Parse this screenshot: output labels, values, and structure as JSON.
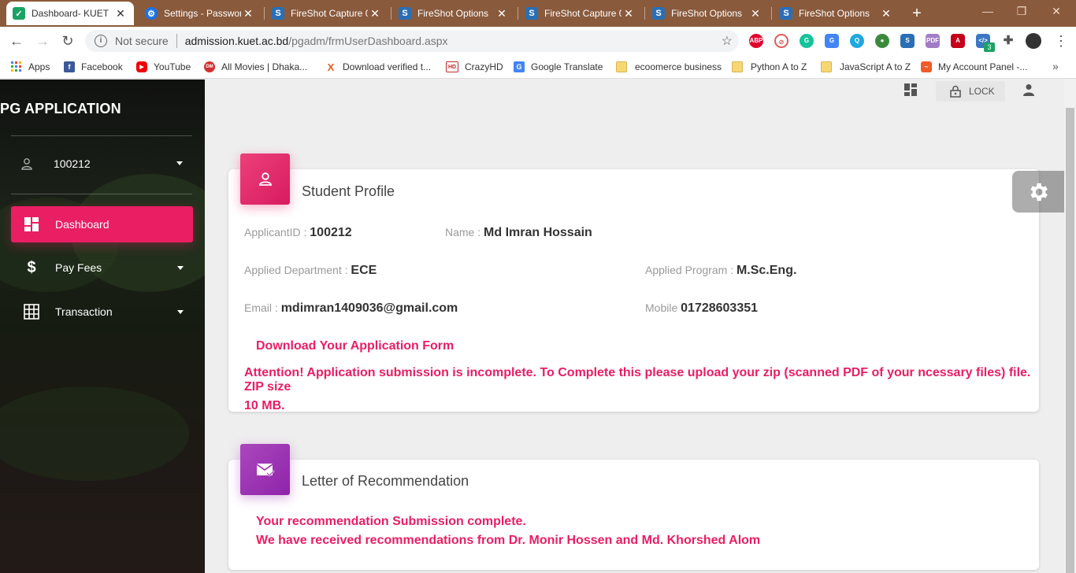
{
  "browser": {
    "tabs": [
      {
        "title": "Dashboard- KUET",
        "active": true,
        "favicon": "shield-icon",
        "color": "#1aa363"
      },
      {
        "title": "Settings - Passwor",
        "active": false,
        "favicon": "gear-icon",
        "color": "#1a73e8"
      },
      {
        "title": "FireShot Capture 0",
        "active": false,
        "favicon": "fireshot-icon",
        "color": "#2a6fb5"
      },
      {
        "title": "FireShot Options",
        "active": false,
        "favicon": "fireshot-icon",
        "color": "#2a6fb5"
      },
      {
        "title": "FireShot Capture 0",
        "active": false,
        "favicon": "fireshot-icon",
        "color": "#2a6fb5"
      },
      {
        "title": "FireShot Options",
        "active": false,
        "favicon": "fireshot-icon",
        "color": "#2a6fb5"
      },
      {
        "title": "FireShot Options",
        "active": false,
        "favicon": "fireshot-icon",
        "color": "#2a6fb5"
      }
    ],
    "security_label": "Not secure",
    "url_host": "admission.kuet.ac.bd",
    "url_path": "/pgadm/frmUserDashboard.aspx",
    "extension_badge": "3",
    "bookmarks": [
      {
        "label": "Apps",
        "icon": "apps-grid-icon",
        "color": "#4285f4"
      },
      {
        "label": "Facebook",
        "icon": "facebook-icon",
        "color": "#3b5998"
      },
      {
        "label": "YouTube",
        "icon": "youtube-icon",
        "color": "#e00"
      },
      {
        "label": "All Movies | Dhaka...",
        "icon": "movie-icon",
        "color": "#d32f2f"
      },
      {
        "label": "Download verified t...",
        "icon": "x-icon",
        "color": "#e25c1f"
      },
      {
        "label": "CrazyHD",
        "icon": "hd-icon",
        "color": "#c62828"
      },
      {
        "label": "Google Translate",
        "icon": "translate-icon",
        "color": "#4285f4"
      },
      {
        "label": "ecoomerce business",
        "icon": "folder-icon",
        "color": "#f7d774"
      },
      {
        "label": "Python A to Z",
        "icon": "folder-icon",
        "color": "#f7d774"
      },
      {
        "label": "JavaScript A to Z",
        "icon": "folder-icon",
        "color": "#f7d774"
      },
      {
        "label": "My Account Panel -...",
        "icon": "account-panel-icon",
        "color": "#f05a28"
      }
    ]
  },
  "sidebar": {
    "title": "PG APPLICATION",
    "user_id": "100212",
    "items": [
      {
        "label": "Dashboard",
        "icon": "dashboard-icon",
        "active": true
      },
      {
        "label": "Pay Fees",
        "icon": "dollar-icon",
        "active": false
      },
      {
        "label": "Transaction",
        "icon": "grid-icon",
        "active": false
      }
    ]
  },
  "topbar": {
    "lock_label": "LOCK"
  },
  "profile": {
    "title": "Student Profile",
    "applicant_id_label": "ApplicantID :",
    "applicant_id": "100212",
    "name_label": "Name :",
    "name": "Md Imran Hossain",
    "department_label": "Applied Department :",
    "department": "ECE",
    "program_label": "Applied Program :",
    "program": "M.Sc.Eng.",
    "email_label": "Email :",
    "email": "mdimran1409036@gmail.com",
    "mobile_label": "Mobile",
    "mobile": "01728603351",
    "download_link": "Download Your Application Form",
    "attention_line1": "Attention! Application submission is incomplete. To Complete this please upload your zip (scanned PDF of your ncessary files) file. ZIP size",
    "attention_line2": "10 MB."
  },
  "recommendation": {
    "title": "Letter of Recommendation",
    "status_line1": "Your recommendation Submission complete.",
    "status_line2": "We have received recommendations from Dr. Monir Hossen and Md. Khorshed Alom"
  },
  "colors": {
    "accent": "#e91e63",
    "recommendation_accent": "#9c27b0",
    "browser_frame": "#8a5a3c"
  }
}
